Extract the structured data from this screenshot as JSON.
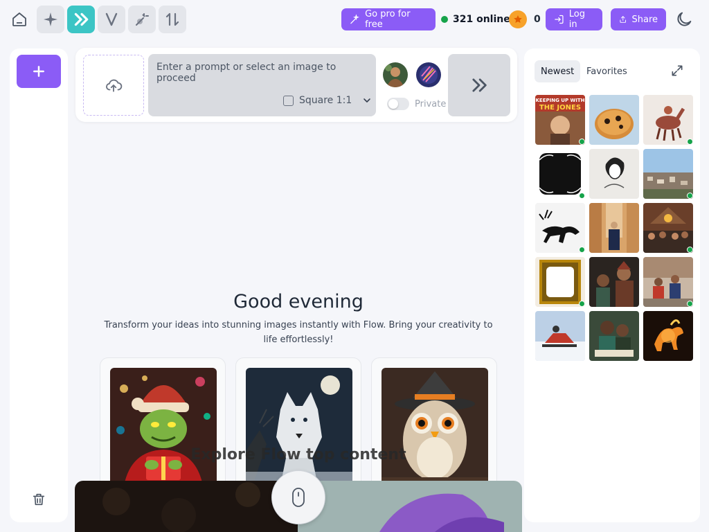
{
  "topbar": {
    "go_pro_label": "Go pro for free",
    "online_label": "321 online",
    "coins": "0",
    "login_label": "Log in",
    "share_label": "Share"
  },
  "prompt": {
    "placeholder": "Enter a prompt or select an image to proceed",
    "aspect_label": "Square 1:1",
    "private_label": "Private"
  },
  "greeting": {
    "title": "Good evening",
    "subtitle": "Transform your ideas into stunning images instantly with Flow. Bring your creativity to life effortlessly!"
  },
  "explore": {
    "label": "Explore Flow top content"
  },
  "gallery": {
    "tab_newest": "Newest",
    "tab_favorites": "Favorites",
    "thumbs": [
      {
        "caption": "KEEPING UP WITH THE JONES",
        "online": true
      },
      {
        "online": false
      },
      {
        "online": true
      },
      {
        "online": true
      },
      {
        "online": false
      },
      {
        "online": true
      },
      {
        "online": true
      },
      {
        "online": false
      },
      {
        "online": true
      },
      {
        "online": true
      },
      {
        "online": false
      },
      {
        "online": true
      },
      {
        "online": false
      },
      {
        "online": false
      },
      {
        "online": false
      }
    ]
  },
  "colors": {
    "accent_purple": "#8b5cf6",
    "active_teal": "#3cc5c5",
    "online_green": "#16a34a"
  }
}
